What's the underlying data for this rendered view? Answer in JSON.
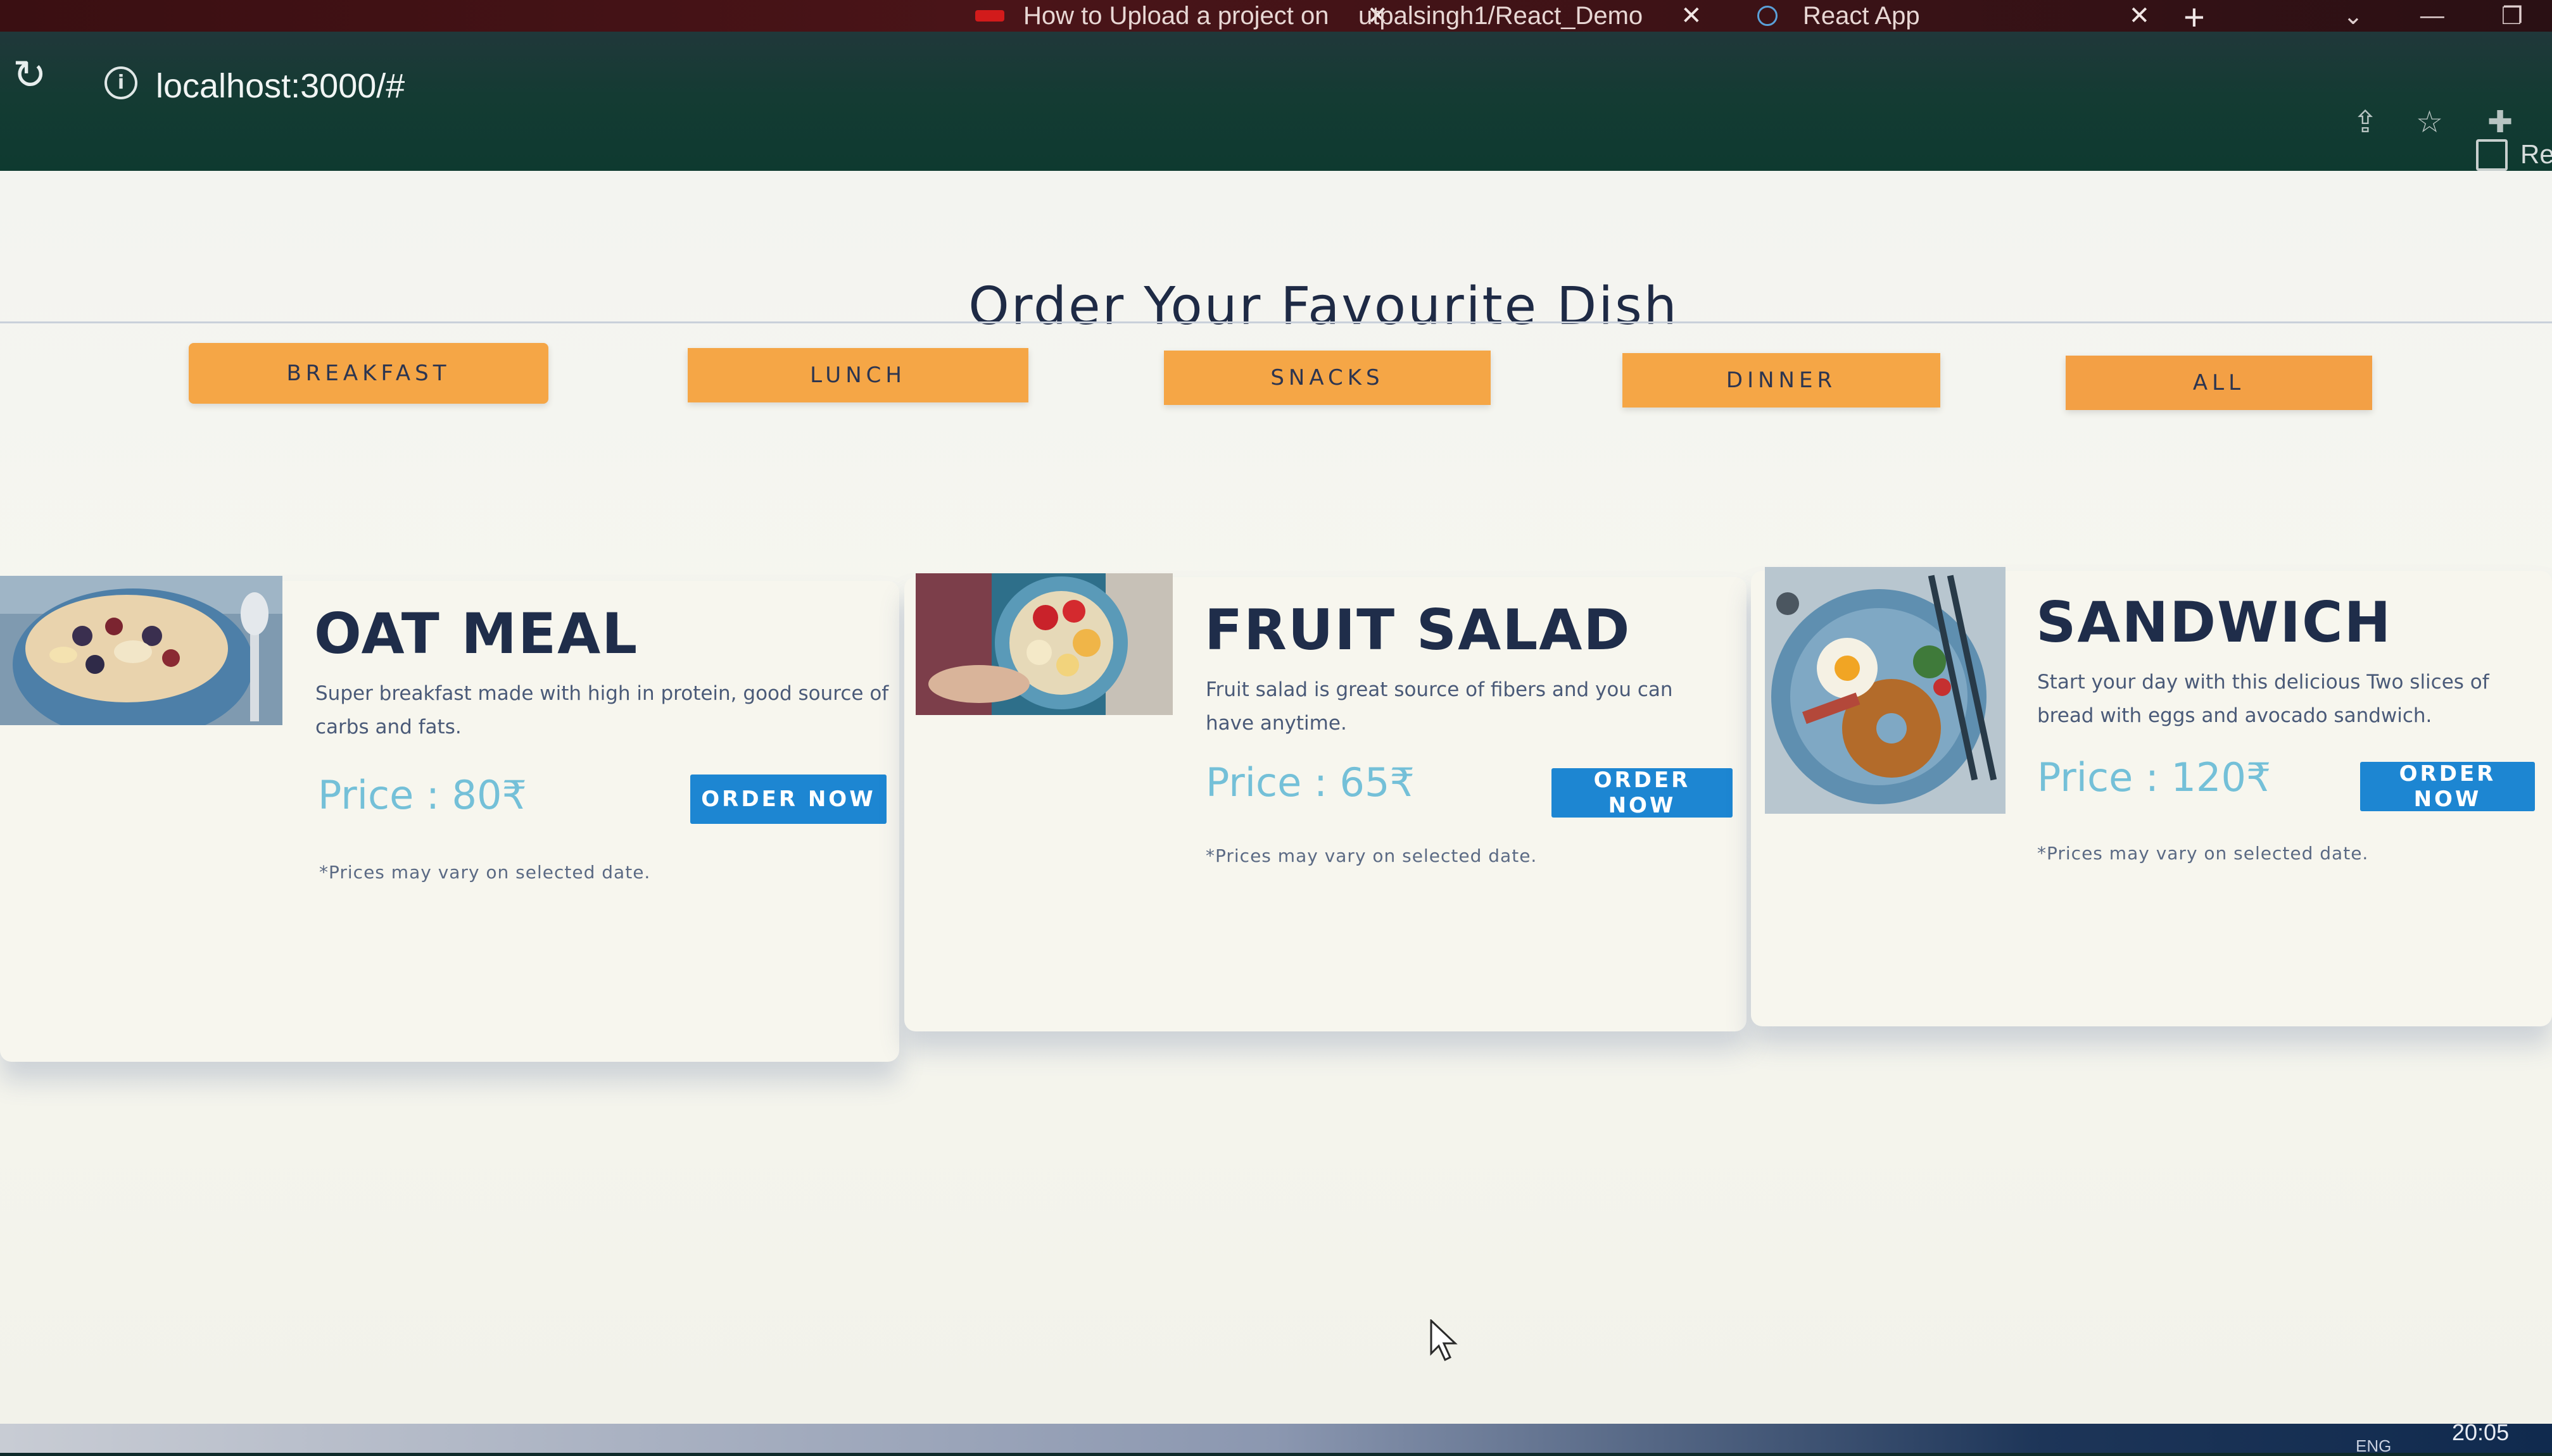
{
  "browser": {
    "tabs": [
      {
        "label": "How to Upload a project on",
        "close": "✕"
      },
      {
        "label": "utpalsingh1/React_Demo",
        "close": "✕"
      },
      {
        "label": "React App",
        "close": "✕"
      }
    ],
    "new_tab": "+",
    "url": "localhost:3000/#",
    "reading_list": "Rea"
  },
  "page": {
    "heading": "Order Your Favourite Dish",
    "categories": [
      "BREAKFAST",
      "LUNCH",
      "SNACKS",
      "DINNER",
      "ALL"
    ],
    "dishes": [
      {
        "title": "OAT MEAL",
        "description": "Super breakfast made with high in protein, good source of carbs and fats.",
        "price": "Price : 80₹",
        "button": "ORDER NOW",
        "note": "*Prices may vary on selected date."
      },
      {
        "title": "FRUIT SALAD",
        "description": "Fruit salad is great source of fibers and you can have anytime.",
        "price": "Price : 65₹",
        "button": "ORDER NOW",
        "note": "*Prices may vary on selected date."
      },
      {
        "title": "SANDWICH",
        "description": "Start your day with this delicious Two slices of bread with eggs and avocado sandwich.",
        "price": "Price : 120₹",
        "button": "ORDER NOW",
        "note": "*Prices may vary on selected date."
      }
    ]
  },
  "taskbar": {
    "clock": "20:05",
    "language": "ENG"
  },
  "colors": {
    "category_button": "#f5a646",
    "order_button": "#1d86d2",
    "price_text": "#74c0d8",
    "heading_text": "#1e2a45"
  }
}
